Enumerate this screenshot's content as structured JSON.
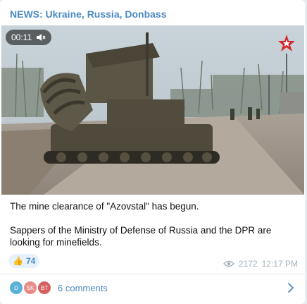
{
  "post": {
    "channel": "NEWS: Ukraine, Russia, Donbass",
    "video": {
      "duration": "00:11",
      "mute_icon": "speaker-muted-icon",
      "logo": "zvezda-red-star-logo"
    },
    "text": {
      "line1": "The mine clearance of \"Azovstal\" has begun.",
      "line2": "Sappers of the Ministry of Defense of Russia and the DPR are looking for minefields."
    },
    "reaction": {
      "emoji": "👍",
      "count": "74"
    },
    "views": "2172",
    "time": "12:17 PM",
    "comments": {
      "label": "6 comments",
      "avatars": [
        {
          "initials": "D",
          "color": "#5ab0d6"
        },
        {
          "initials": "SK",
          "color": "#e88a8a"
        },
        {
          "initials": "BT",
          "color": "#d65f5f"
        }
      ]
    }
  },
  "colors": {
    "accent": "#4a8bc2",
    "meta": "#a4b0ba"
  }
}
